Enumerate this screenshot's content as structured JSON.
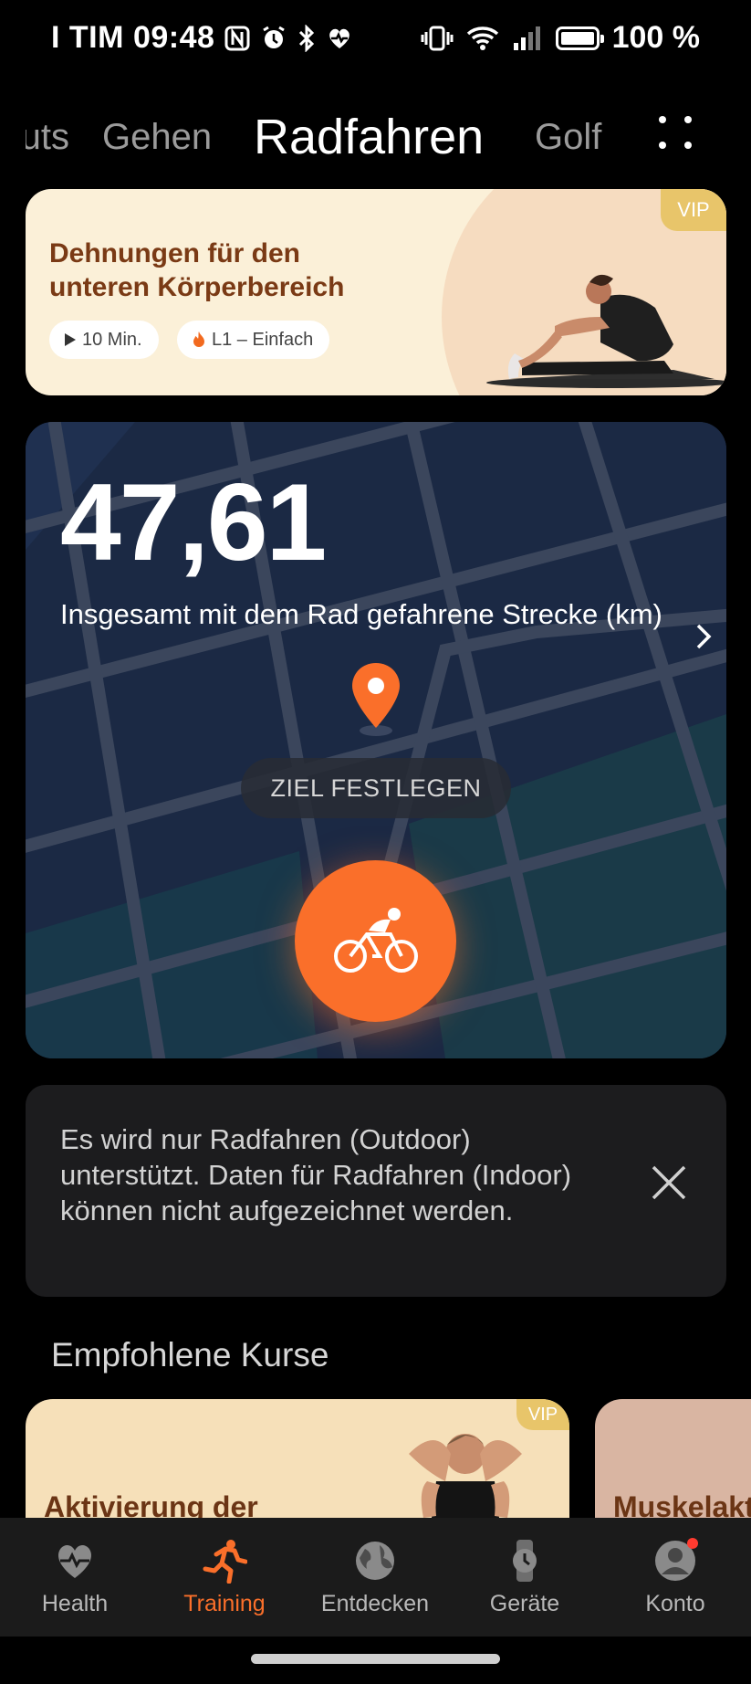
{
  "status_bar": {
    "carrier": "I TIM",
    "time": "09:48",
    "battery": "100 %",
    "battery_level": 1.0
  },
  "tabs": [
    {
      "label": "uts",
      "active": false
    },
    {
      "label": "Gehen",
      "active": false
    },
    {
      "label": "Radfahren",
      "active": true
    },
    {
      "label": "Golf",
      "active": false
    }
  ],
  "banner": {
    "title": "Dehnungen für den unteren Körperbereich",
    "duration": "10 Min.",
    "level": "L1 – Einfach",
    "vip": "VIP"
  },
  "map_card": {
    "distance": "47,61",
    "distance_label": "Insgesamt mit dem Rad gefahrene Strecke (km)",
    "goal_button": "ZIEL FESTLEGEN"
  },
  "notice": {
    "text": "Es wird nur Radfahren (Outdoor) unterstützt. Daten für Radfahren (Indoor) können nicht aufgezeichnet werden."
  },
  "recommended": {
    "title": "Empfohlene Kurse",
    "courses": [
      {
        "title": "Aktivierung der",
        "vip": "VIP"
      },
      {
        "title": "Muskelakt"
      }
    ]
  },
  "bottom_nav": [
    {
      "label": "Health",
      "icon": "heart-pulse-icon",
      "active": false
    },
    {
      "label": "Training",
      "icon": "running-icon",
      "active": true
    },
    {
      "label": "Entdecken",
      "icon": "globe-icon",
      "active": false
    },
    {
      "label": "Geräte",
      "icon": "watch-icon",
      "active": false
    },
    {
      "label": "Konto",
      "icon": "profile-icon",
      "active": false
    }
  ],
  "colors": {
    "accent": "#fa6f2a",
    "map_bg": "#1a2742",
    "banner_bg": "#fbf0d8",
    "vip": "#e8c56a"
  }
}
